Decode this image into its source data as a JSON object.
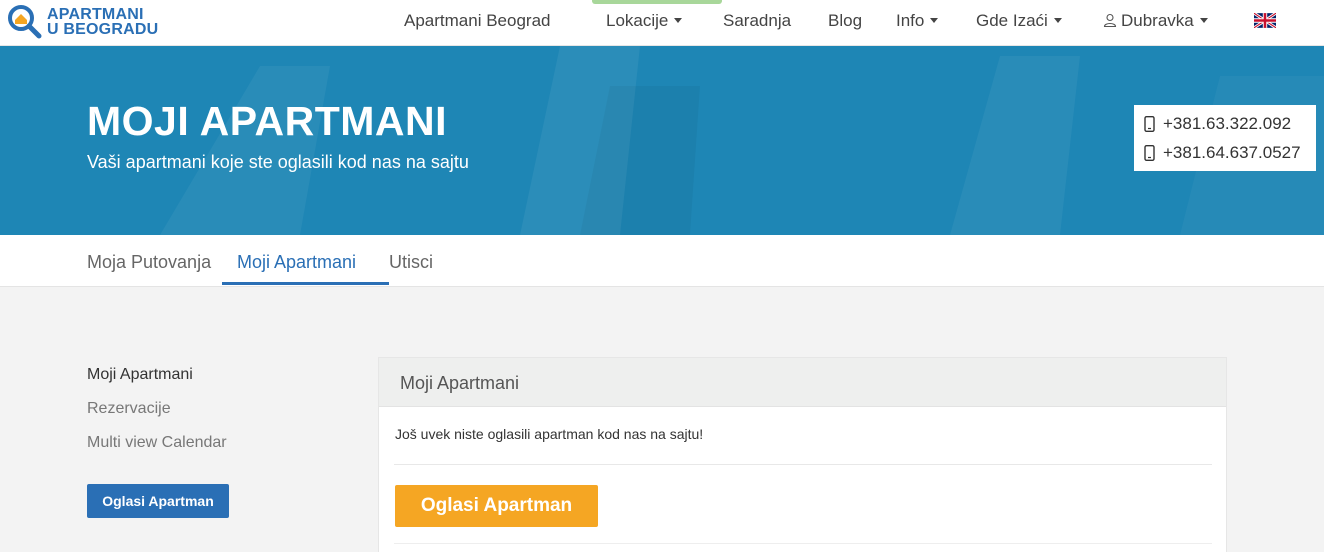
{
  "header": {
    "logo_line1": "APARTMANI",
    "logo_line2": "U BEOGRADU",
    "nav": [
      {
        "label": "Apartmani Beograd",
        "dropdown": false
      },
      {
        "label": "Lokacije",
        "dropdown": true
      },
      {
        "label": "Saradnja",
        "dropdown": false
      },
      {
        "label": "Blog",
        "dropdown": false
      },
      {
        "label": "Info",
        "dropdown": true
      },
      {
        "label": "Gde Izaći",
        "dropdown": true
      },
      {
        "label": "Dubravka",
        "dropdown": true
      }
    ],
    "language": "en-GB"
  },
  "hero": {
    "title": "MOJI APARTMANI",
    "subtitle": "Vaši apartmani koje ste oglasili kod nas na sajtu",
    "phones": [
      "+381.63.322.092",
      "+381.64.637.0527"
    ]
  },
  "tabs": [
    {
      "label": "Moja Putovanja",
      "active": false
    },
    {
      "label": "Moji Apartmani",
      "active": true
    },
    {
      "label": "Utisci",
      "active": false
    }
  ],
  "sidebar": {
    "items": [
      {
        "label": "Moji Apartmani",
        "active": true
      },
      {
        "label": "Rezervacije",
        "active": false
      },
      {
        "label": "Multi view Calendar",
        "active": false
      }
    ],
    "button_label": "Oglasi Apartman"
  },
  "panel": {
    "title": "Moji Apartmani",
    "message": "Još uvek niste oglasili apartman kod nas na sajtu!",
    "button_label": "Oglasi Apartman"
  },
  "colors": {
    "primary": "#2a6fb5",
    "hero_bg": "#1e86b5",
    "accent_orange": "#f5a623",
    "page_bg": "#f3f3f3"
  }
}
